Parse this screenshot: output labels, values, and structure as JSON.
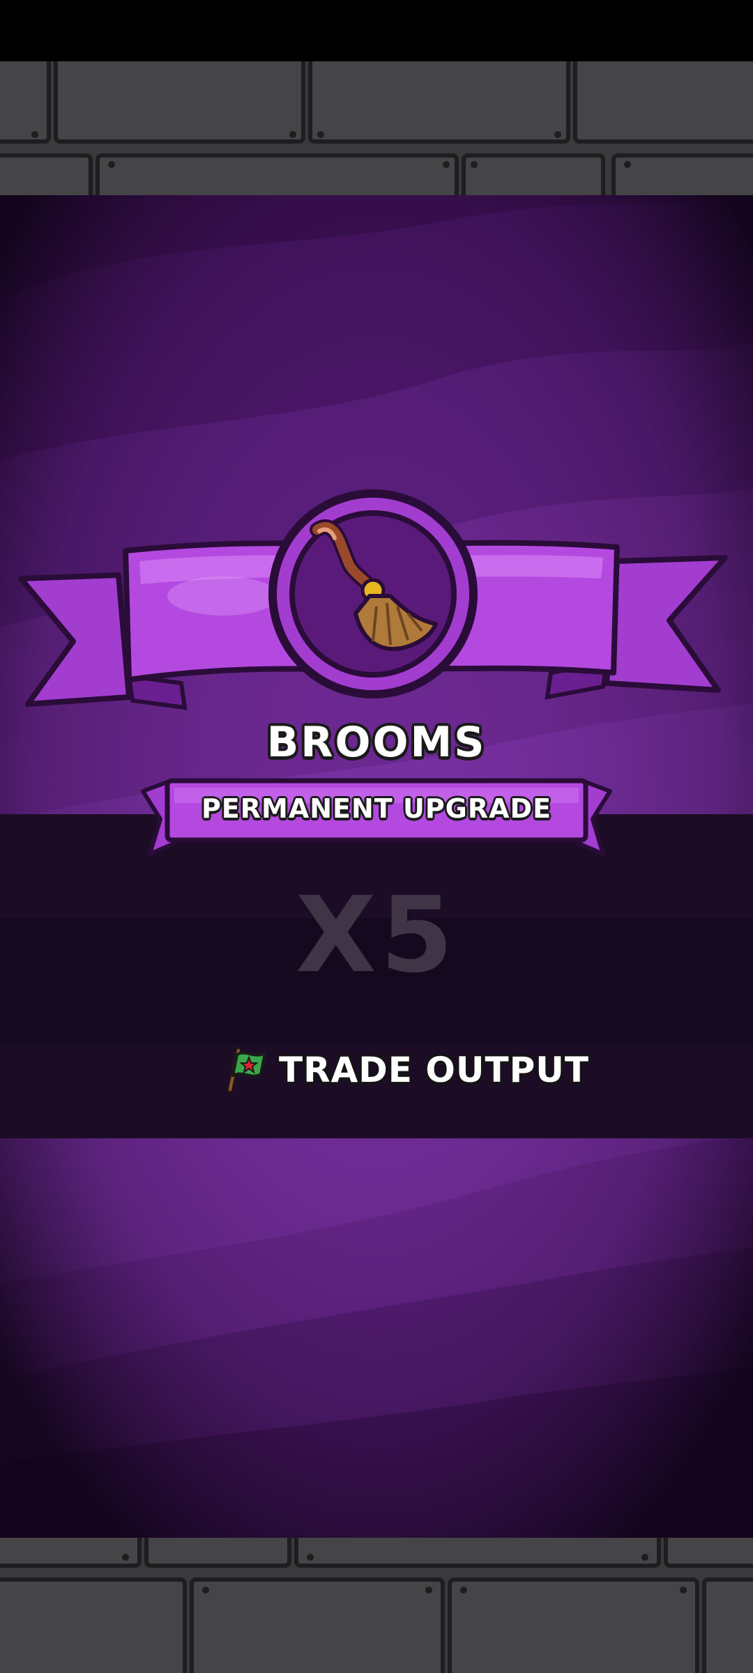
{
  "reward": {
    "title": "BROOMS",
    "subtitle": "PERMANENT UPGRADE",
    "multiplier": "X5",
    "effect_label": "TRADE OUTPUT",
    "item_icon": "broom-icon",
    "effect_icon": "flag-icon"
  },
  "colors": {
    "panel_purple": "#4a1668",
    "ribbon_purple": "#b449e0",
    "dark_band": "#1c0c25",
    "stone_gray": "#3b3b3d",
    "multiplier_text": "#3f3546"
  }
}
